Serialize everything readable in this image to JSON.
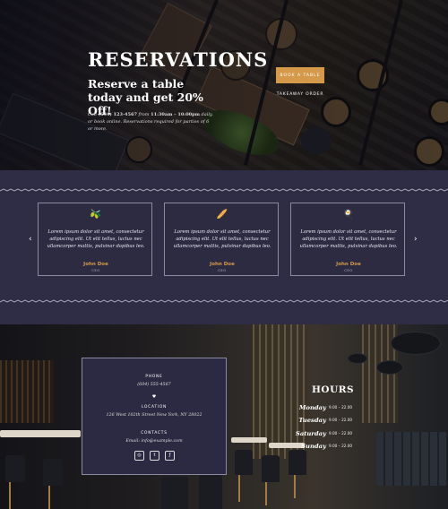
{
  "hero": {
    "title": "RESERVATIONS",
    "subtitle": "Reserve a table today and get 20% Off!",
    "info_prefix": "Call ",
    "info_phone": "(634) 123-4567",
    "info_mid": " from ",
    "info_hours": "11:30am – 10:00pm",
    "info_suffix": " daily, or book online. Reservations required for parties of 6 or more.",
    "book_label": "BOOK A TABLE",
    "takeaway_label": "TAKEAWAY ORDER"
  },
  "testimonials": {
    "prev": "‹",
    "next": "›",
    "cards": [
      {
        "icon": "olives-icon",
        "glyph": "🫒",
        "text": "Lorem ipsum dolor sit amet, consectetur adipiscing elit. Ut elit tellus, luctus nec ullamcorper mattis, pulvinar dapibus leo.",
        "name": "John Doe",
        "role": "CEO"
      },
      {
        "icon": "bread-icon",
        "glyph": "🥖",
        "text": "Lorem ipsum dolor sit amet, consectetur adipiscing elit. Ut elit tellus, luctus nec ullamcorper mattis, pulvinar dapibus leo.",
        "name": "John Doe",
        "role": "CEO"
      },
      {
        "icon": "egg-icon",
        "glyph": "🍳",
        "text": "Lorem ipsum dolor sit amet, consectetur adipiscing elit. Ut elit tellus, luctus nec ullamcorper mattis, pulvinar dapibus leo.",
        "name": "John Doe",
        "role": "CEO"
      }
    ]
  },
  "contact": {
    "phone_label": "PHONE",
    "phone": "(604) 555-4567",
    "heart": "♥",
    "location_label": "LOCATION",
    "location": "126 West 102th Street New York, NY 28022",
    "contacts_label": "CONTACTS",
    "email": "Email: info@example.com",
    "social": [
      {
        "name": "instagram-icon",
        "glyph": "◎"
      },
      {
        "name": "twitter-icon",
        "glyph": "t"
      },
      {
        "name": "foursquare-icon",
        "glyph": "ƒ"
      }
    ]
  },
  "hours": {
    "title": "HOURS",
    "rows": [
      {
        "day": "Monday",
        "time": "9.00 – 22.00"
      },
      {
        "day": "Tuesday",
        "time": "9.00 – 22.00"
      },
      {
        "day": "Saturday",
        "time": "9.00 – 22.00"
      },
      {
        "day": "Sunday",
        "time": "9.00 – 22.00"
      }
    ]
  },
  "colors": {
    "accent": "#d49a4a",
    "panel": "#2c2a42",
    "border": "#8b8aa3"
  }
}
